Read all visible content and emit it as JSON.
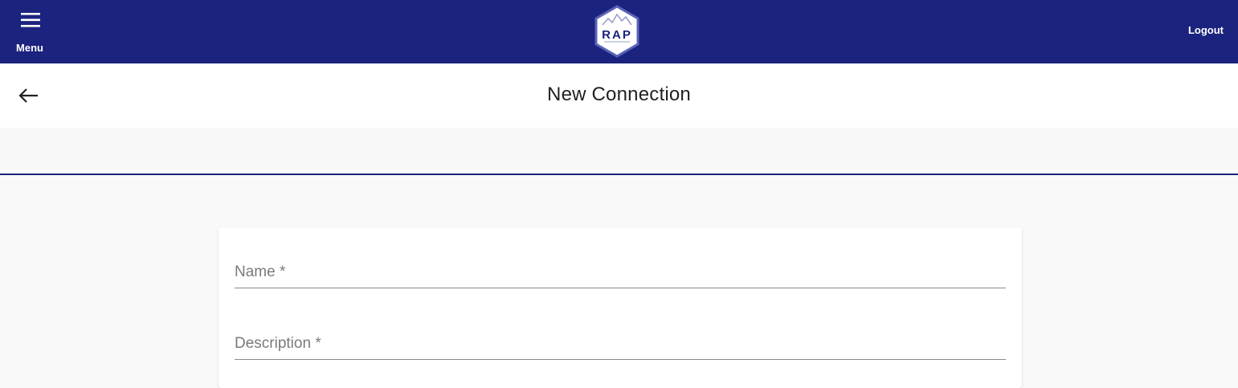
{
  "header": {
    "menu_label": "Menu",
    "menu_icon": "hamburger-menu-icon",
    "logo_text": "RAP",
    "logout_label": "Logout",
    "brand_color": "#1b237e"
  },
  "titlebar": {
    "back_icon": "arrow-left-icon",
    "title": "New Connection"
  },
  "form": {
    "name_label": "Name *",
    "name_value": "",
    "description_label": "Description *",
    "description_value": ""
  }
}
